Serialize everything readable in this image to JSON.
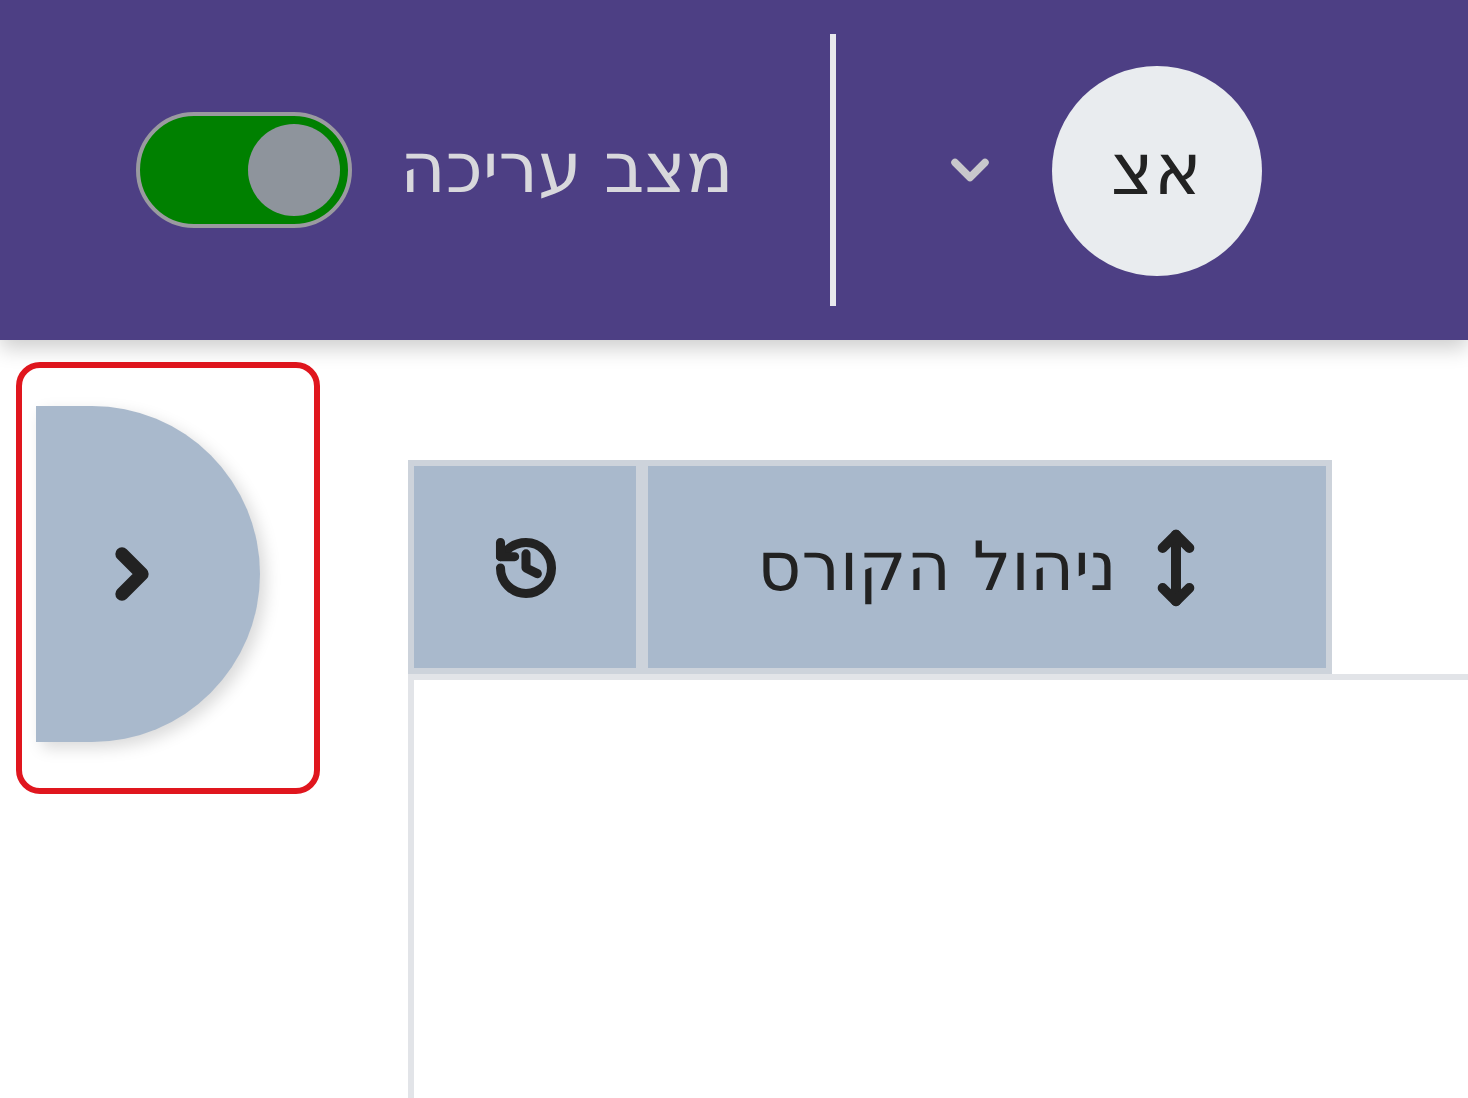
{
  "header": {
    "edit_mode": {
      "label": "מצב עריכה",
      "on": true
    },
    "user": {
      "initials": "אצ"
    }
  },
  "drawer_toggle": {
    "highlighted": true
  },
  "course_admin": {
    "label": "ניהול הקורס"
  }
}
